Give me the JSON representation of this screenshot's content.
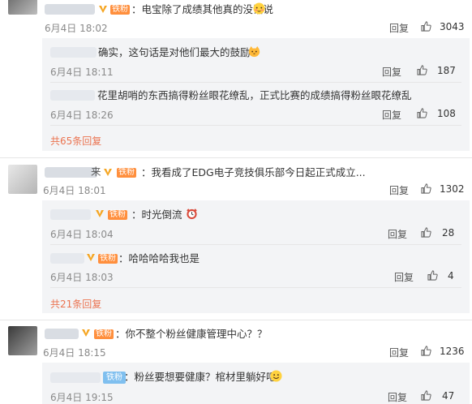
{
  "comments": [
    {
      "text": "：电宝除了成绩其他真的没话说",
      "time": "6月4日 18:02",
      "likes": "3043",
      "badge": "铁粉",
      "emoji": "blush-face",
      "replies": [
        {
          "text": "确实，这句话是对他们最大的鼓励",
          "time": "6月4日 18:11",
          "likes": "187",
          "emoji": "cat-face"
        },
        {
          "text": "花里胡哨的东西搞得粉丝眼花缭乱，正式比赛的成绩搞得粉丝眼花缭乱",
          "time": "6月4日 18:26",
          "likes": "108"
        }
      ],
      "more": "共65条回复"
    },
    {
      "text": "：我看成了EDG电子竞技俱乐部今日起正式成立...",
      "time": "6月4日 18:01",
      "likes": "1302",
      "badge": "铁粉",
      "replies": [
        {
          "text": "：时光倒流",
          "time": "6月4日 18:04",
          "likes": "28",
          "badge": "铁粉",
          "emoji": "clock"
        },
        {
          "text": "：哈哈哈哈我也是",
          "time": "6月4日 18:03",
          "likes": "4",
          "badge": "铁粉"
        }
      ],
      "more": "共21条回复"
    },
    {
      "text": "：你不整个粉丝健康管理中心？？",
      "time": "6月4日 18:15",
      "likes": "1236",
      "badge": "铁粉",
      "replies": [
        {
          "text": "：粉丝要想要健康？棺材里躺好吧",
          "time": "6月4日 19:15",
          "likes": "47",
          "badge": "铁粉",
          "emoji": "smile-face"
        }
      ]
    }
  ],
  "labels": {
    "reply": "回复"
  },
  "colors": {
    "more": "#eb7350",
    "fan_badge": "#ff8f3d",
    "plain_badge": "#7fbfef",
    "sub_bg": "#f3f4f6"
  }
}
